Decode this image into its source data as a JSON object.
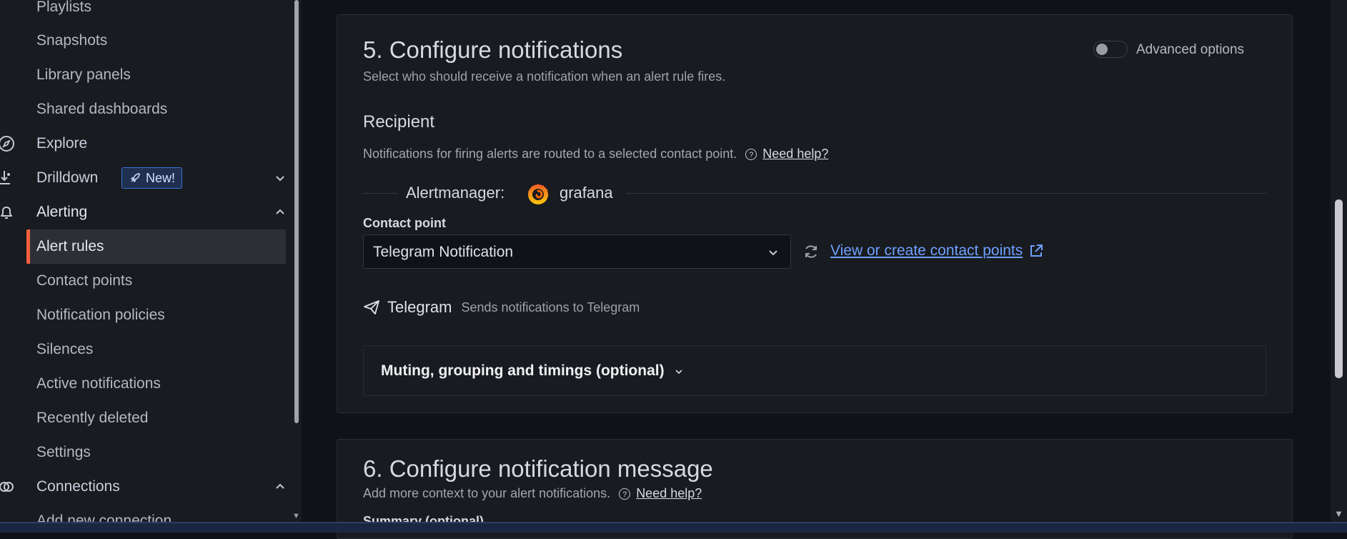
{
  "sidebar": {
    "items": [
      {
        "label": "Playlists"
      },
      {
        "label": "Snapshots"
      },
      {
        "label": "Library panels"
      },
      {
        "label": "Shared dashboards"
      },
      {
        "label": "Explore"
      },
      {
        "label": "Drilldown",
        "badge": "New!"
      },
      {
        "label": "Alerting"
      },
      {
        "label": "Alert rules"
      },
      {
        "label": "Contact points"
      },
      {
        "label": "Notification policies"
      },
      {
        "label": "Silences"
      },
      {
        "label": "Active notifications"
      },
      {
        "label": "Recently deleted"
      },
      {
        "label": "Settings"
      },
      {
        "label": "Connections"
      },
      {
        "label": "Add new connection"
      }
    ],
    "active_item": "Alert rules"
  },
  "section5": {
    "title": "5. Configure notifications",
    "description": "Select who should receive a notification when an alert rule fires.",
    "advanced_label": "Advanced options",
    "advanced_enabled": false,
    "recipient_title": "Recipient",
    "recipient_desc": "Notifications for firing alerts are routed to a selected contact point.",
    "help_link": "Need help?",
    "alertmanager_label": "Alertmanager:",
    "alertmanager_name": "grafana",
    "contact_point_label": "Contact point",
    "contact_point_value": "Telegram Notification",
    "contact_points_link": "View or create contact points",
    "integration_name": "Telegram",
    "integration_desc": "Sends notifications to Telegram",
    "muting_title": "Muting, grouping and timings (optional)"
  },
  "section6": {
    "title": "6. Configure notification message",
    "description": "Add more context to your alert notifications.",
    "help_link": "Need help?",
    "summary_label": "Summary (optional)"
  },
  "colors": {
    "accent_link": "#6e9fff",
    "active_indicator": "#f55f3e",
    "background": "#111217",
    "panel": "#181b1f"
  }
}
